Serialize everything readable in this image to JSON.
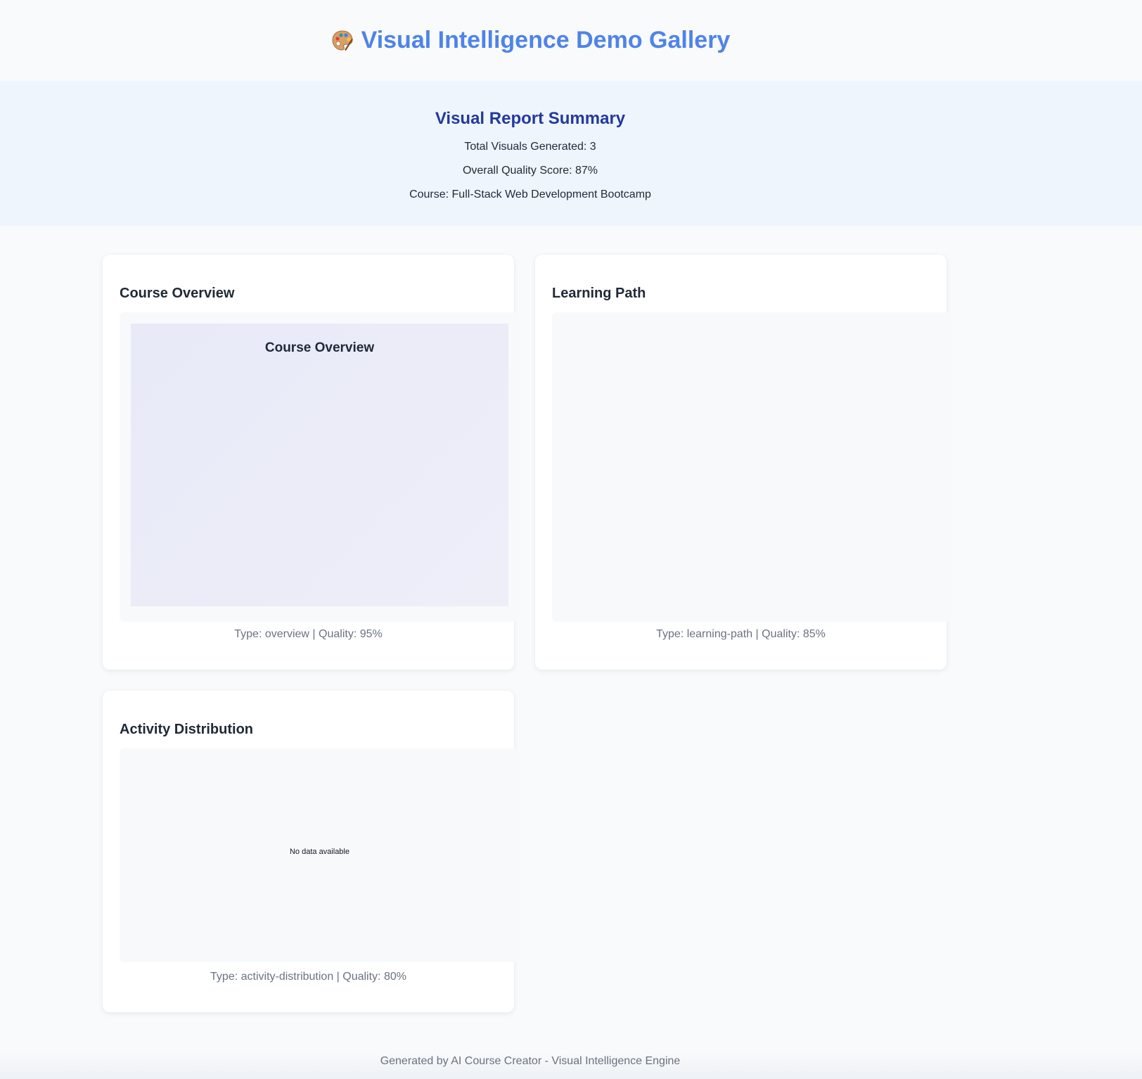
{
  "header": {
    "title": "Visual Intelligence Demo Gallery",
    "icon": "palette-icon"
  },
  "summary": {
    "title": "Visual Report Summary",
    "total_visuals": "Total Visuals Generated: 3",
    "quality_score": "Overall Quality Score: 87%",
    "course": "Course: Full-Stack Web Development Bootcamp"
  },
  "cards": [
    {
      "title": "Course Overview",
      "canvas_title": "Course Overview",
      "meta": "Type: overview | Quality: 95%"
    },
    {
      "title": "Learning Path",
      "meta": "Type: learning-path | Quality: 85%"
    },
    {
      "title": "Activity Distribution",
      "empty_text": "No data available",
      "meta": "Type: activity-distribution | Quality: 80%"
    }
  ],
  "footer": {
    "text": "Generated by AI Course Creator - Visual Intelligence Engine"
  },
  "colors": {
    "title_blue": "#4f83e8",
    "summary_title": "#23399c",
    "summary_bg": "#eef5fd"
  }
}
